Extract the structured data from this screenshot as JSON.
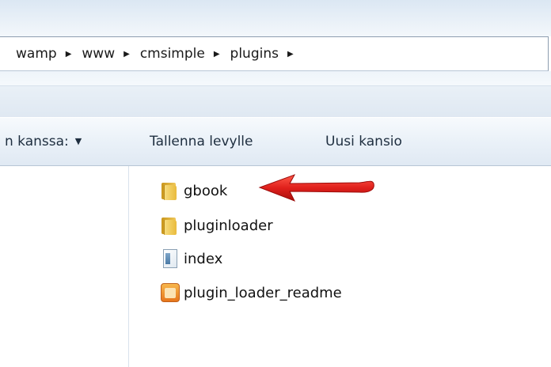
{
  "breadcrumb": {
    "segments": [
      "wamp",
      "www",
      "cmsimple",
      "plugins"
    ],
    "separator": "▶"
  },
  "toolbar": {
    "share_label": "n kanssa:",
    "share_arrow": "▼",
    "save_label": "Tallenna levylle",
    "new_folder_label": "Uusi kansio"
  },
  "files": [
    {
      "name": "gbook",
      "icon": "folder-icon"
    },
    {
      "name": "pluginloader",
      "icon": "folder-icon"
    },
    {
      "name": "index",
      "icon": "document-icon"
    },
    {
      "name": "plugin_loader_readme",
      "icon": "readme-icon"
    }
  ],
  "colors": {
    "annotation_arrow": "#e0201c"
  }
}
